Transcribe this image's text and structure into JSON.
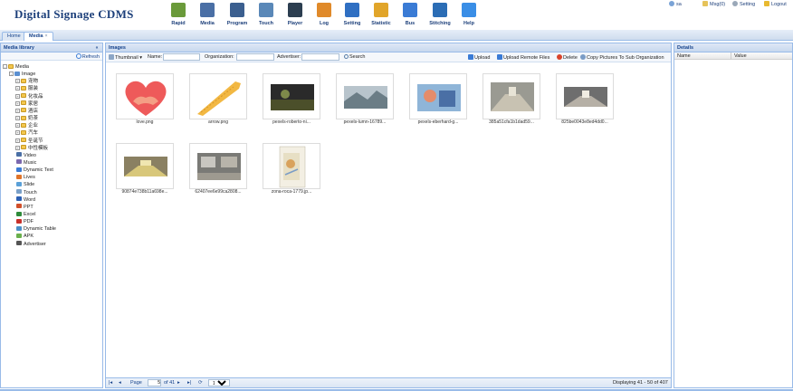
{
  "app": {
    "title": "Digital Signage CDMS"
  },
  "nav": [
    {
      "label": "Rapid",
      "icon": "rapid-icon",
      "color": "#6a9a3a"
    },
    {
      "label": "Media",
      "icon": "media-icon",
      "color": "#4a6fa5"
    },
    {
      "label": "Program",
      "icon": "program-icon",
      "color": "#3b5f8f"
    },
    {
      "label": "Touch",
      "icon": "touch-icon",
      "color": "#5a88b8"
    },
    {
      "label": "Player",
      "icon": "player-icon",
      "color": "#2c3e50"
    },
    {
      "label": "Log",
      "icon": "log-icon",
      "color": "#e08a2a"
    },
    {
      "label": "Setting",
      "icon": "setting-icon",
      "color": "#2f6fc2"
    },
    {
      "label": "Statistic",
      "icon": "statistic-icon",
      "color": "#e1a52a"
    },
    {
      "label": "Bus",
      "icon": "bus-icon",
      "color": "#3a7bd5"
    },
    {
      "label": "Stitching",
      "icon": "stitching-icon",
      "color": "#2b6db5"
    },
    {
      "label": "Help",
      "icon": "help-icon",
      "color": "#3a8ee6"
    }
  ],
  "user_links": {
    "user": "sa",
    "msg": "Msg(0)",
    "setting": "Setting",
    "logout": "Logout"
  },
  "tabs": [
    {
      "label": "Home",
      "active": false
    },
    {
      "label": "Media",
      "active": true
    }
  ],
  "library": {
    "title": "Media library",
    "refresh": "Refresh",
    "tree": [
      {
        "label": "Media",
        "level": 0,
        "expander": "-",
        "kind": "folder"
      },
      {
        "label": "Image",
        "level": 1,
        "expander": "-",
        "kind": "image"
      },
      {
        "label": "宠物",
        "level": 2,
        "expander": "+",
        "kind": "folder"
      },
      {
        "label": "服装",
        "level": 2,
        "expander": "+",
        "kind": "folder"
      },
      {
        "label": "化妆品",
        "level": 2,
        "expander": "+",
        "kind": "folder"
      },
      {
        "label": "家居",
        "level": 2,
        "expander": "+",
        "kind": "folder"
      },
      {
        "label": "酒店",
        "level": 2,
        "expander": "+",
        "kind": "folder"
      },
      {
        "label": "奶茶",
        "level": 2,
        "expander": "+",
        "kind": "folder"
      },
      {
        "label": "企业",
        "level": 2,
        "expander": "+",
        "kind": "folder"
      },
      {
        "label": "汽车",
        "level": 2,
        "expander": "+",
        "kind": "folder"
      },
      {
        "label": "圣诞节",
        "level": 2,
        "expander": "+",
        "kind": "folder"
      },
      {
        "label": "中性模板",
        "level": 2,
        "expander": "+",
        "kind": "folder"
      },
      {
        "label": "Video",
        "level": 1,
        "expander": "",
        "kind": "video"
      },
      {
        "label": "Music",
        "level": 1,
        "expander": "",
        "kind": "music"
      },
      {
        "label": "Dynamic Text",
        "level": 1,
        "expander": "",
        "kind": "text"
      },
      {
        "label": "Lives",
        "level": 1,
        "expander": "",
        "kind": "lives"
      },
      {
        "label": "Slide",
        "level": 1,
        "expander": "",
        "kind": "slide"
      },
      {
        "label": "Touch",
        "level": 1,
        "expander": "",
        "kind": "touch"
      },
      {
        "label": "Word",
        "level": 1,
        "expander": "",
        "kind": "word"
      },
      {
        "label": "PPT",
        "level": 1,
        "expander": "",
        "kind": "ppt"
      },
      {
        "label": "Excel",
        "level": 1,
        "expander": "",
        "kind": "excel"
      },
      {
        "label": "PDF",
        "level": 1,
        "expander": "",
        "kind": "pdf"
      },
      {
        "label": "Dynamic Table",
        "level": 1,
        "expander": "",
        "kind": "table"
      },
      {
        "label": "APK",
        "level": 1,
        "expander": "",
        "kind": "apk"
      },
      {
        "label": "Advertiser",
        "level": 1,
        "expander": "",
        "kind": "advertiser"
      }
    ]
  },
  "images": {
    "title": "Images",
    "toolbar": {
      "view_label": "Thumbnail",
      "name_label": "Name:",
      "name_value": "",
      "org_label": "Organization:",
      "org_value": "",
      "adv_label": "Advertiser:",
      "adv_value": "",
      "search": "Search",
      "upload": "Upload",
      "upload_remote": "Upload Remote Files",
      "delete": "Delete",
      "copy": "Copy Pictures To Sub Organization"
    },
    "items": [
      {
        "name": "love.png",
        "kind": "heart"
      },
      {
        "name": "arrow.png",
        "kind": "arrow"
      },
      {
        "name": "pexels-roberto-ni...",
        "kind": "photo-dark"
      },
      {
        "name": "pexels-lumn-16789...",
        "kind": "photo-sky"
      },
      {
        "name": "pexels-eberhard-g...",
        "kind": "photo-color"
      },
      {
        "name": "385a51cfa1b1dad59...",
        "kind": "photo-mall"
      },
      {
        "name": "825be0043e8ed4dd0...",
        "kind": "photo-hall"
      },
      {
        "name": "90874e738b11a698e...",
        "kind": "photo-yellow"
      },
      {
        "name": "62407ee6e99ca2808...",
        "kind": "photo-shop"
      },
      {
        "name": "zona-roca-1779.jp...",
        "kind": "photo-map"
      }
    ]
  },
  "pager": {
    "page_label": "Page",
    "page_value": "5",
    "of_label": "of 41",
    "page_size": "10",
    "displaying": "Displaying 41 - 50 of 407"
  },
  "details": {
    "title": "Details",
    "col_name": "Name",
    "col_value": "Value"
  }
}
